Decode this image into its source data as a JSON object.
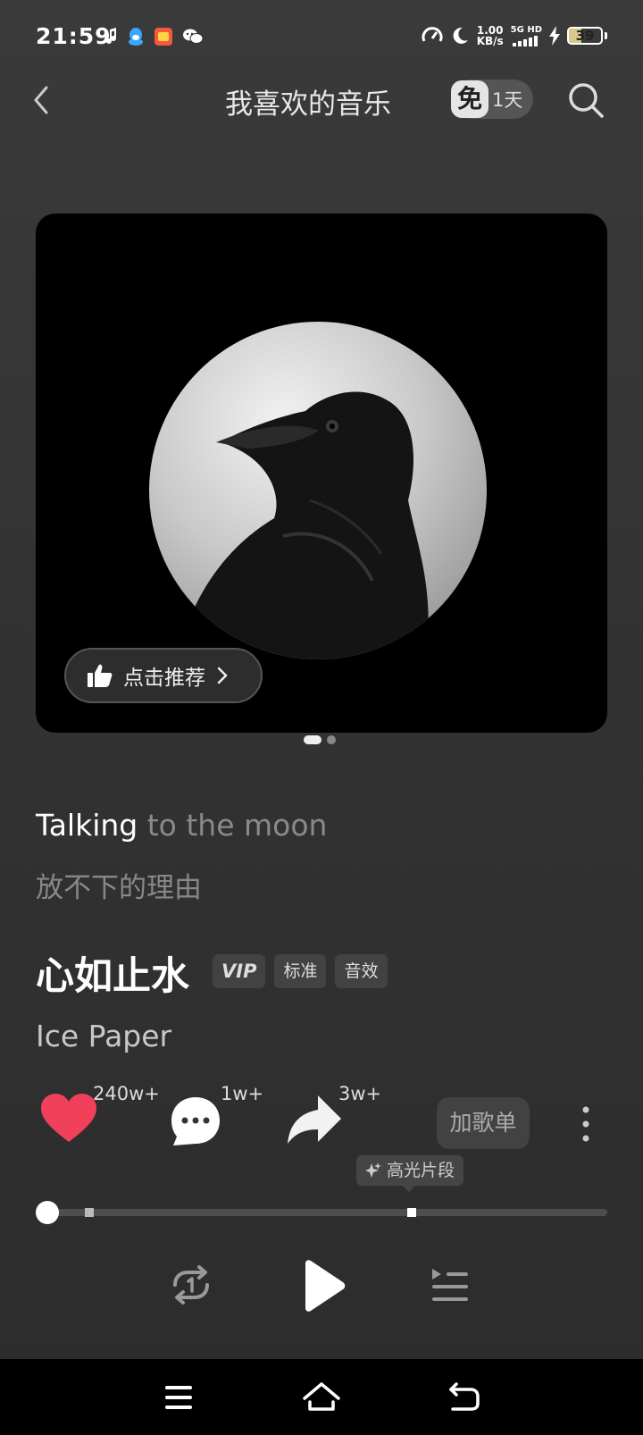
{
  "status_bar": {
    "time": "21:59",
    "net_speed_value": "1.00",
    "net_speed_unit": "KB/s",
    "network": "5G HD",
    "battery_level": "39",
    "battery_fraction": 0.39
  },
  "header": {
    "title": "我喜欢的音乐",
    "free_badge_icon": "免",
    "free_badge_days": "1天"
  },
  "album": {
    "recommend_label": "点击推荐",
    "pager_total": 2,
    "pager_active": 1
  },
  "lyrics": {
    "line1_highlight": "Talking",
    "line1_rest": " to the moon",
    "line2": "放不下的理由"
  },
  "song": {
    "title": "心如止水",
    "tags": [
      "VIP",
      "标准",
      "音效"
    ],
    "artist": "Ice Paper"
  },
  "actions": {
    "like_count": "240w+",
    "comment_count": "1w+",
    "share_count": "3w+",
    "add_playlist_label": "加歌单",
    "highlight_label": "高光片段"
  },
  "playback": {
    "progress_fraction": 0.0,
    "is_playing": false
  },
  "colors": {
    "like": "#f0405a",
    "background": "#333333",
    "nav_bar": "#000000"
  }
}
